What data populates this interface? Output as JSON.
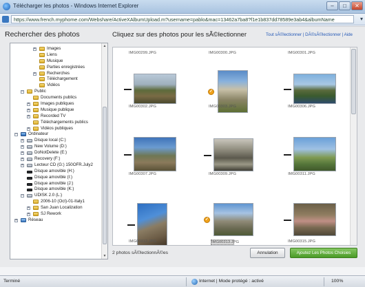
{
  "window": {
    "title": "Télécharger les photos - Windows Internet Explorer",
    "address": "https://www.french.myphome.com/Webshare/ActiveXAlbumUpload.m?username=pablo&mac=13462a7ba8?f1e1b837dd78589e3ab4&albumName",
    "buttons": [
      "–",
      "□",
      "✕"
    ]
  },
  "left": {
    "title": "Rechercher des photos",
    "tree": [
      {
        "label": "Images",
        "indent": 3,
        "icon": "folder",
        "toggle": "+"
      },
      {
        "label": "Liens",
        "indent": 3,
        "icon": "folder",
        "toggle": ""
      },
      {
        "label": "Musique",
        "indent": 3,
        "icon": "folder",
        "toggle": ""
      },
      {
        "label": "Parties enregistrées",
        "indent": 3,
        "icon": "folder",
        "toggle": ""
      },
      {
        "label": "Recherches",
        "indent": 3,
        "icon": "folder",
        "toggle": "+"
      },
      {
        "label": "Téléchargement",
        "indent": 3,
        "icon": "folder",
        "toggle": ""
      },
      {
        "label": "Vidéos",
        "indent": 3,
        "icon": "folder",
        "toggle": ""
      },
      {
        "label": "Public",
        "indent": 1,
        "icon": "folder",
        "toggle": "–"
      },
      {
        "label": "Documents publics",
        "indent": 2,
        "icon": "folder",
        "toggle": ""
      },
      {
        "label": "Images publiques",
        "indent": 2,
        "icon": "folder",
        "toggle": "+"
      },
      {
        "label": "Musique publique",
        "indent": 2,
        "icon": "folder",
        "toggle": "+"
      },
      {
        "label": "Recorded TV",
        "indent": 2,
        "icon": "folder",
        "toggle": "+"
      },
      {
        "label": "Téléchargements publics",
        "indent": 2,
        "icon": "folder",
        "toggle": ""
      },
      {
        "label": "Vidéos publiques",
        "indent": 2,
        "icon": "folder",
        "toggle": "+"
      },
      {
        "label": "Ordinateur",
        "indent": 0,
        "icon": "computer",
        "toggle": "–"
      },
      {
        "label": "Disque local (C:)",
        "indent": 1,
        "icon": "drive",
        "toggle": "+"
      },
      {
        "label": "New Volume (D:)",
        "indent": 1,
        "icon": "drive",
        "toggle": "+"
      },
      {
        "label": "DoNotDelete (E:)",
        "indent": 1,
        "icon": "drive",
        "toggle": "+"
      },
      {
        "label": "Recovery (F:)",
        "indent": 1,
        "icon": "drive",
        "toggle": "+"
      },
      {
        "label": "Lecteur CD (G:) 150OFR.July2",
        "indent": 1,
        "icon": "drive",
        "toggle": "+"
      },
      {
        "label": "Disque amovible (H:)",
        "indent": 1,
        "icon": "blackdrive",
        "toggle": ""
      },
      {
        "label": "Disque amovible (I:)",
        "indent": 1,
        "icon": "blackdrive",
        "toggle": ""
      },
      {
        "label": "Disque amovible (J:)",
        "indent": 1,
        "icon": "blackdrive",
        "toggle": ""
      },
      {
        "label": "Disque amovible (K:)",
        "indent": 1,
        "icon": "blackdrive",
        "toggle": ""
      },
      {
        "label": "UDISK 2.0 (L:)",
        "indent": 1,
        "icon": "drive",
        "toggle": "–"
      },
      {
        "label": "2006-10 (Oct)-01-Italy1",
        "indent": 2,
        "icon": "folder",
        "toggle": ""
      },
      {
        "label": "San Juan Localization",
        "indent": 2,
        "icon": "folder",
        "toggle": "+"
      },
      {
        "label": "SJ Rework",
        "indent": 2,
        "icon": "folder",
        "toggle": "+"
      },
      {
        "label": "Réseau",
        "indent": 0,
        "icon": "blue",
        "toggle": "+"
      }
    ]
  },
  "main": {
    "title": "Cliquez sur des photos pour les sÃ©lectionner",
    "link_select_all": "Tout sÃ©lectionner",
    "link_separator": "|",
    "link_deselect_all": "DÃ©sÃ©lectionner",
    "link_help": "| Aide",
    "top_row_names": [
      "IMG00299.JPG",
      "IMG00300.JPG",
      "IMG00301.JPG"
    ],
    "photos": [
      {
        "name": "IMG00302.JPG",
        "selected": false,
        "scene": "valley"
      },
      {
        "name": "IMG00303.JPG",
        "selected": true,
        "scene": "mountain"
      },
      {
        "name": "IMG00306.JPG",
        "selected": false,
        "scene": "lake"
      },
      {
        "name": "IMG00307.JPG",
        "selected": false,
        "scene": "town"
      },
      {
        "name": "IMG00309.JPG",
        "selected": false,
        "scene": "road"
      },
      {
        "name": "IMG00311.JPG",
        "selected": false,
        "scene": "meadow"
      },
      {
        "name": "IMG00312.JPG",
        "selected": false,
        "scene": "cliff"
      },
      {
        "name": "IMG00313.JPG",
        "selected": true,
        "scene": "peak"
      },
      {
        "name": "IMG00315.JPG",
        "selected": false,
        "scene": "person"
      }
    ],
    "selection_count": "2 photos sÃ©lectionnÃ©es",
    "cancel_label": "Annulation",
    "add_label": "Ajoutez Les Photos Choisies"
  },
  "statusbar": {
    "done": "Terminé",
    "zone": "Internet | Mode protégé : activé",
    "zoom": "100%"
  }
}
